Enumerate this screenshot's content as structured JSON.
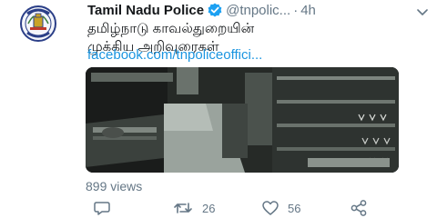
{
  "tweet": {
    "account_name": "Tamil Nadu Police",
    "handle": "@tnpolic...",
    "separator": "·",
    "timestamp": "4h",
    "text_lines": [
      "தமிழ்நாடு காவல்துறையின்",
      "முக்கிய அறிவுரைகள்"
    ],
    "link": "facebook.com/tnpoliceoffici...",
    "views": "899 views"
  },
  "actions": {
    "retweets": "26",
    "likes": "56"
  },
  "icons": {
    "avatar": "tamil-nadu-police-emblem",
    "verified": "verified-badge-icon",
    "menu": "chevron-down-icon",
    "reply": "reply-icon",
    "retweet": "retweet-icon",
    "like": "heart-icon",
    "share": "share-icon"
  },
  "colors": {
    "link": "#1b95e0",
    "verified": "#1da1f2",
    "muted": "#657786"
  }
}
